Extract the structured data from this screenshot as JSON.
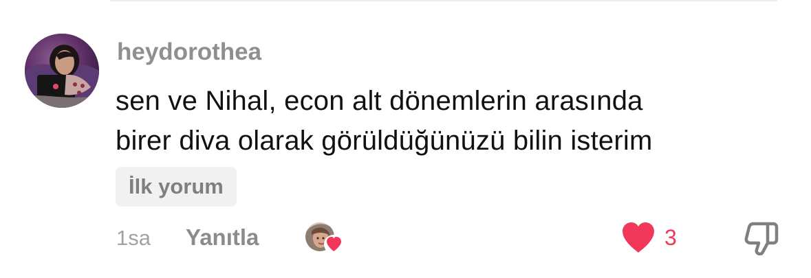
{
  "comment": {
    "username": "heydorothea",
    "text_lines": [
      "sen ve Nihal, econ alt dönemlerin arasında",
      "birer diva olarak görüldüğünüzü bilin isterim"
    ],
    "badge": "İlk yorum",
    "timestamp": "1sa",
    "reply_label": "Yanıtla",
    "like_count": "3"
  },
  "icons": {
    "avatar": "user-avatar",
    "creator_liked": "creator-liked-avatar-heart",
    "like": "heart-icon",
    "dislike": "thumbs-down-icon"
  },
  "colors": {
    "like_accent": "#f2385a",
    "username": "#8f8f8f",
    "badge_background": "#f1f1f2"
  }
}
